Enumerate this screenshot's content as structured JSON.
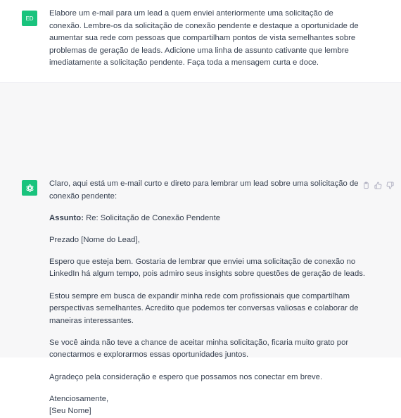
{
  "user": {
    "initials": "ED",
    "message": "Elabore um e-mail para um lead a quem enviei anteriormente uma solicitação de conexão. Lembre-os da solicitação de conexão pendente e destaque a oportunidade de aumentar sua rede com pessoas que compartilham pontos de vista semelhantes sobre problemas de geração de leads. Adicione uma linha de assunto cativante que lembre imediatamente a solicitação pendente. Faça toda a mensagem curta e doce."
  },
  "assistant": {
    "intro": "Claro, aqui está um e-mail curto e direto para lembrar um lead sobre uma solicitação de conexão pendente:",
    "subject_label": "Assunto:",
    "subject_text": " Re: Solicitação de Conexão Pendente",
    "greeting": "Prezado [Nome do Lead],",
    "p1": "Espero que esteja bem. Gostaria de lembrar que enviei uma solicitação de conexão no LinkedIn há algum tempo, pois admiro seus insights sobre questões de geração de leads.",
    "p2": "Estou sempre em busca de expandir minha rede com profissionais que compartilham perspectivas semelhantes. Acredito que podemos ter conversas valiosas e colaborar de maneiras interessantes.",
    "p3": "Se você ainda não teve a chance de aceitar minha solicitação, ficaria muito grato por conectarmos e explorarmos essas oportunidades juntos.",
    "p4": "Agradeço pela consideração e espero que possamos nos conectar em breve.",
    "closing": "Atenciosamente,",
    "signature": "[Seu Nome]"
  },
  "icons": {
    "copy": "clipboard-icon",
    "like": "thumbs-up-icon",
    "dislike": "thumbs-down-icon",
    "avatar": "openai-logo-icon"
  },
  "colors": {
    "accent": "#19c37d",
    "bot_bg": "#f7f7f8",
    "text": "#374151"
  }
}
